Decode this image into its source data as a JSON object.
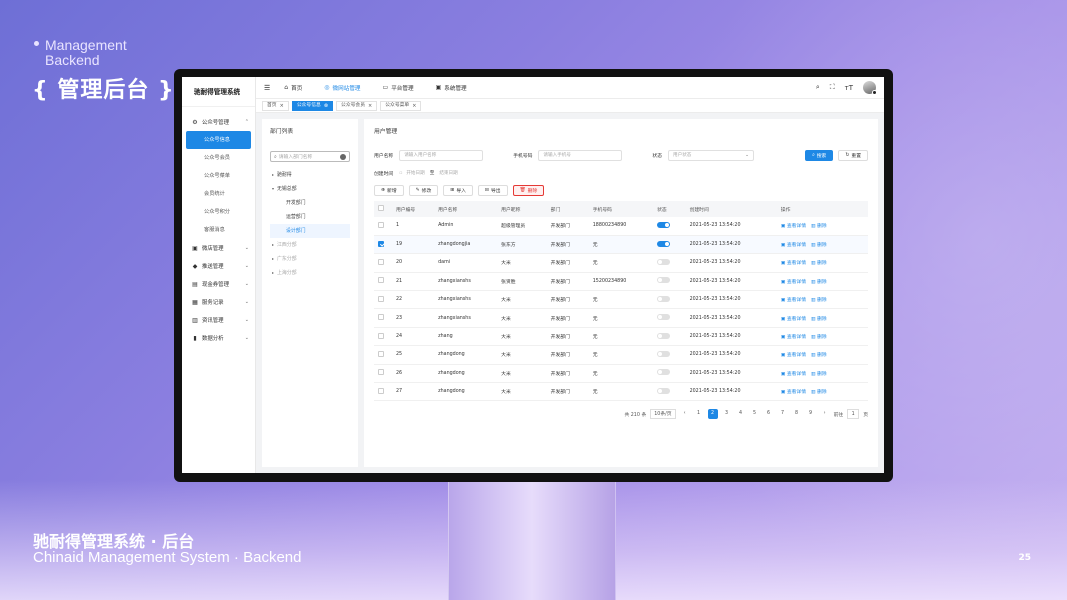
{
  "slide": {
    "tag_line1": "Management",
    "tag_line2": "Backend",
    "hero_title": "{ 管理后台 }",
    "footer_cn": "驰耐得管理系统 · 后台",
    "footer_en": "Chinaid Management System · Backend",
    "page_number": "25"
  },
  "app": {
    "logo": "驰耐得管理系统",
    "top_nav": [
      {
        "label": "首页",
        "icon": "home-icon"
      },
      {
        "label": "微网站管理",
        "icon": "globe-icon",
        "active": true
      },
      {
        "label": "平台管理",
        "icon": "platform-icon"
      },
      {
        "label": "系统管理",
        "icon": "system-icon"
      }
    ],
    "tabs": [
      {
        "label": "首页"
      },
      {
        "label": "公众号信息",
        "active": true
      },
      {
        "label": "公众号会员"
      },
      {
        "label": "公众号菜单"
      }
    ],
    "sidebar": {
      "group1": {
        "label": "公众号管理",
        "icon": "gear-icon"
      },
      "subitems": [
        "公众号信息",
        "公众号会员",
        "公众号菜单",
        "会员统计",
        "公众号积分",
        "客服消息"
      ],
      "groups": [
        {
          "label": "微店管理",
          "icon": "shop-icon"
        },
        {
          "label": "推送管理",
          "icon": "bell-icon"
        },
        {
          "label": "现金券管理",
          "icon": "coupon-icon"
        },
        {
          "label": "服务记录",
          "icon": "record-icon"
        },
        {
          "label": "资讯管理",
          "icon": "news-icon"
        },
        {
          "label": "数据分析",
          "icon": "chart-icon"
        }
      ]
    },
    "dept": {
      "title": "部门列表",
      "search_placeholder": "请输入部门名称",
      "tree": [
        "驰耐得",
        "无锡总部",
        "开发部门",
        "运营部门",
        "设计部门",
        "江西分部",
        "广东分部",
        "上海分部"
      ]
    },
    "users": {
      "title": "用户管理",
      "filter_name_label": "用户名称",
      "filter_name_placeholder": "请输入用户名称",
      "filter_phone_label": "手机号码",
      "filter_phone_placeholder": "请输入手机号",
      "filter_status_label": "状态",
      "filter_status_placeholder": "用户状态",
      "filter_time_label": "创建时间",
      "filter_start_placeholder": "开始日期",
      "filter_to": "至",
      "filter_end_placeholder": "结束日期",
      "search_btn": "搜索",
      "reset_btn": "重置",
      "toolbar": {
        "add": "新增",
        "edit": "修改",
        "import": "导入",
        "export": "导出",
        "delete": "删除"
      },
      "columns": [
        "用户编号",
        "用户名称",
        "用户昵称",
        "部门",
        "手机号码",
        "状态",
        "创建时间",
        "操作"
      ],
      "rows": [
        {
          "id": "1",
          "name": "Admin",
          "nick": "超级管理员",
          "dept": "开发部门",
          "phone": "18800234890",
          "status": true,
          "created": "2021-05-23 13:54:20",
          "checked": false
        },
        {
          "id": "19",
          "name": "zhangdongjia",
          "nick": "张东方",
          "dept": "开发部门",
          "phone": "无",
          "status": true,
          "created": "2021-05-23 13:54:20",
          "checked": true
        },
        {
          "id": "20",
          "name": "dami",
          "nick": "大米",
          "dept": "开发部门",
          "phone": "无",
          "status": false,
          "created": "2021-05-23 13:54:20",
          "checked": false
        },
        {
          "id": "21",
          "name": "zhangxianshs",
          "nick": "张贤胜",
          "dept": "开发部门",
          "phone": "15200234890",
          "status": false,
          "created": "2021-05-23 13:54:20",
          "checked": false
        },
        {
          "id": "22",
          "name": "zhangxianshs",
          "nick": "大米",
          "dept": "开发部门",
          "phone": "无",
          "status": false,
          "created": "2021-05-23 13:54:20",
          "checked": false
        },
        {
          "id": "23",
          "name": "zhangxianshs",
          "nick": "大米",
          "dept": "开发部门",
          "phone": "无",
          "status": false,
          "created": "2021-05-23 13:54:20",
          "checked": false
        },
        {
          "id": "24",
          "name": "zhang",
          "nick": "大米",
          "dept": "开发部门",
          "phone": "无",
          "status": false,
          "created": "2021-05-23 13:54:20",
          "checked": false
        },
        {
          "id": "25",
          "name": "zhangdong",
          "nick": "大米",
          "dept": "开发部门",
          "phone": "无",
          "status": false,
          "created": "2021-05-23 13:54:20",
          "checked": false
        },
        {
          "id": "26",
          "name": "zhangdong",
          "nick": "大米",
          "dept": "开发部门",
          "phone": "无",
          "status": false,
          "created": "2021-05-23 13:54:20",
          "checked": false
        },
        {
          "id": "27",
          "name": "zhangdong",
          "nick": "大米",
          "dept": "开发部门",
          "phone": "无",
          "status": false,
          "created": "2021-05-23 13:54:20",
          "checked": false
        }
      ],
      "op_view": "查看详情",
      "op_delete": "删除",
      "pager": {
        "total": "共 210 条",
        "page_size": "10条/页",
        "pages": [
          "1",
          "2",
          "3",
          "4",
          "5",
          "6",
          "7",
          "8",
          "9"
        ],
        "current": "2",
        "goto_label": "前往",
        "goto_value": "1",
        "page_unit": "页"
      }
    }
  },
  "colors": {
    "accent": "#1e88e5",
    "danger": "#e53935",
    "background_purple": "#8b7fe0"
  }
}
